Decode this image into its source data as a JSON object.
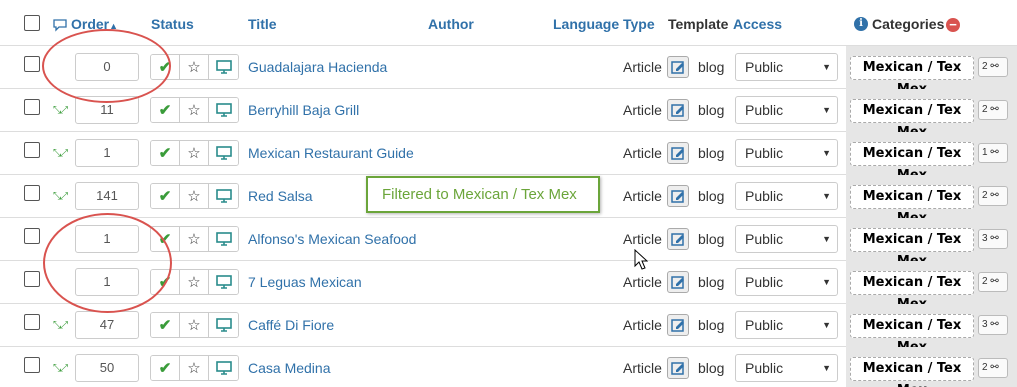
{
  "header": {
    "order": "Order",
    "status": "Status",
    "title": "Title",
    "author": "Author",
    "language": "Language",
    "type": "Type",
    "template": "Template",
    "access": "Access",
    "categories": "Categories"
  },
  "rows": [
    {
      "order": "0",
      "title": "Guadalajara Hacienda",
      "type": "Article",
      "template": "blog",
      "access": "Public",
      "category": "Mexican / Tex Mex",
      "count": "2"
    },
    {
      "order": "11",
      "title": "Berryhill Baja Grill",
      "type": "Article",
      "template": "blog",
      "access": "Public",
      "category": "Mexican / Tex Mex",
      "count": "2"
    },
    {
      "order": "1",
      "title": "Mexican Restaurant Guide",
      "type": "Article",
      "template": "blog",
      "access": "Public",
      "category": "Mexican / Tex Mex",
      "count": "1"
    },
    {
      "order": "141",
      "title": "Red Salsa",
      "type": "Article",
      "template": "blog",
      "access": "Public",
      "category": "Mexican / Tex Mex",
      "count": "2"
    },
    {
      "order": "1",
      "title": "Alfonso's Mexican Seafood",
      "type": "Article",
      "template": "blog",
      "access": "Public",
      "category": "Mexican / Tex Mex",
      "count": "3"
    },
    {
      "order": "1",
      "title": "7 Leguas Mexican",
      "type": "Article",
      "template": "blog",
      "access": "Public",
      "category": "Mexican / Tex Mex",
      "count": "2"
    },
    {
      "order": "47",
      "title": "Caffé Di Fiore",
      "type": "Article",
      "template": "blog",
      "access": "Public",
      "category": "Mexican / Tex Mex",
      "count": "3"
    },
    {
      "order": "50",
      "title": "Casa Medina",
      "type": "Article",
      "template": "blog",
      "access": "Public",
      "category": "Mexican / Tex Mex",
      "count": "2"
    }
  ],
  "callout": "Filtered to Mexican / Tex Mex",
  "colors": {
    "link": "#3071a9",
    "check": "#3a9c3a",
    "callout": "#6ba53a",
    "annotation": "#d9534f"
  }
}
